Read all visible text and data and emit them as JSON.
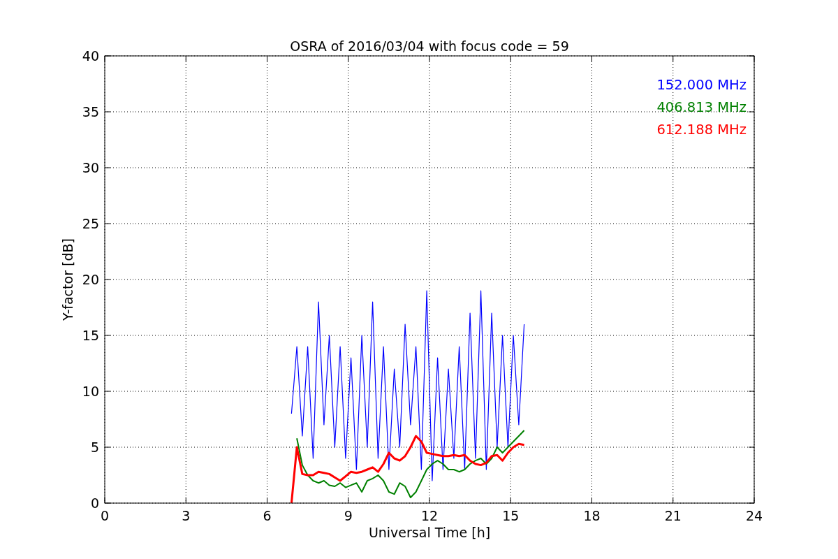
{
  "figure": {
    "chart_data": {
      "type": "line",
      "title": "OSRA of 2016/03/04 with focus code = 59",
      "xlabel": "Universal Time [h]",
      "ylabel": "Y-factor [dB]",
      "x": [
        6.9,
        7.1,
        7.3,
        7.5,
        7.7,
        7.9,
        8.1,
        8.3,
        8.5,
        8.7,
        8.9,
        9.1,
        9.3,
        9.5,
        9.7,
        9.9,
        10.1,
        10.3,
        10.5,
        10.7,
        10.9,
        11.1,
        11.3,
        11.5,
        11.7,
        11.9,
        12.1,
        12.3,
        12.5,
        12.7,
        12.9,
        13.1,
        13.3,
        13.5,
        13.7,
        13.9,
        14.1,
        14.3,
        14.5,
        14.7,
        14.9,
        15.1,
        15.3,
        15.5
      ],
      "series": [
        {
          "name": "152.000 MHz",
          "color": "#0000ff",
          "values": [
            8,
            14,
            6,
            14,
            4,
            18,
            7,
            15,
            5,
            14,
            4,
            13,
            3,
            15,
            5,
            18,
            4,
            14,
            3,
            12,
            5,
            16,
            7,
            14,
            3,
            19,
            2,
            13,
            3,
            12,
            4,
            14,
            3,
            17,
            4,
            19,
            3,
            17,
            5,
            15,
            5,
            15,
            7,
            16
          ]
        },
        {
          "name": "406.813 MHz",
          "color": "#008000",
          "values": [
            null,
            5.8,
            3.4,
            2.5,
            2,
            1.8,
            2,
            1.6,
            1.5,
            1.8,
            1.4,
            1.6,
            1.8,
            1,
            2,
            2.2,
            2.5,
            2,
            1,
            0.8,
            1.8,
            1.5,
            0.5,
            1,
            2,
            3,
            3.5,
            3.8,
            3.5,
            3,
            3,
            2.8,
            3,
            3.5,
            3.8,
            4,
            3.5,
            4,
            5,
            4.5,
            5,
            5.5,
            6,
            6.5
          ]
        },
        {
          "name": "612.188 MHz",
          "color": "#ff0000",
          "values": [
            0,
            5,
            2.6,
            2.5,
            2.5,
            2.8,
            2.7,
            2.6,
            2.3,
            2,
            2.4,
            2.8,
            2.7,
            2.8,
            3,
            3.2,
            2.8,
            3.5,
            4.5,
            4,
            3.8,
            4.2,
            5,
            6,
            5.5,
            4.5,
            4.4,
            4.3,
            4.2,
            4.2,
            4.3,
            4.2,
            4.3,
            3.8,
            3.5,
            3.4,
            3.6,
            4.2,
            4.3,
            3.8,
            4.5,
            5,
            5.3,
            5.2
          ]
        }
      ],
      "grid": true,
      "xlim": [
        0,
        24
      ],
      "ylim": [
        0,
        40
      ],
      "xticks": [
        0,
        3,
        6,
        9,
        12,
        15,
        18,
        21,
        24
      ],
      "yticks": [
        0,
        5,
        10,
        15,
        20,
        25,
        30,
        35,
        40
      ]
    }
  }
}
